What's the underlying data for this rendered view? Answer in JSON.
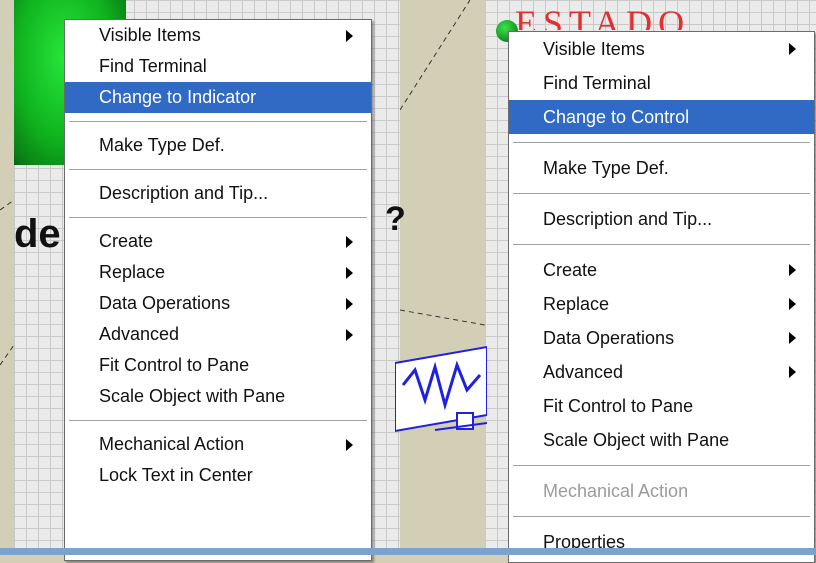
{
  "background": {
    "left_label": "de",
    "left_label_suffix": "?",
    "right_title": "ESTADO"
  },
  "menu_left": {
    "items": [
      {
        "label": "Visible Items",
        "submenu": true
      },
      {
        "label": "Find Terminal"
      },
      {
        "label": "Change to Indicator",
        "selected": true
      },
      {
        "separator": true
      },
      {
        "label": "Make Type Def."
      },
      {
        "separator": true
      },
      {
        "label": "Description and Tip..."
      },
      {
        "separator": true
      },
      {
        "label": "Create",
        "submenu": true
      },
      {
        "label": "Replace",
        "submenu": true
      },
      {
        "label": "Data Operations",
        "submenu": true
      },
      {
        "label": "Advanced",
        "submenu": true
      },
      {
        "label": "Fit Control to Pane"
      },
      {
        "label": "Scale Object with Pane"
      },
      {
        "separator": true
      },
      {
        "label": "Mechanical Action",
        "submenu": true
      },
      {
        "label": "Lock Text in Center"
      }
    ]
  },
  "menu_right": {
    "items": [
      {
        "label": "Visible Items",
        "submenu": true
      },
      {
        "label": "Find Terminal"
      },
      {
        "label": "Change to Control",
        "selected": true
      },
      {
        "separator": true
      },
      {
        "label": "Make Type Def."
      },
      {
        "separator": true
      },
      {
        "label": "Description and Tip..."
      },
      {
        "separator": true
      },
      {
        "label": "Create",
        "submenu": true
      },
      {
        "label": "Replace",
        "submenu": true
      },
      {
        "label": "Data Operations",
        "submenu": true
      },
      {
        "label": "Advanced",
        "submenu": true
      },
      {
        "label": "Fit Control to Pane"
      },
      {
        "label": "Scale Object with Pane"
      },
      {
        "separator": true
      },
      {
        "label": "Mechanical Action",
        "disabled": true
      },
      {
        "separator": true
      },
      {
        "label": "Properties"
      }
    ]
  },
  "colors": {
    "selection": "#316ac5",
    "knob_green": "#0fb21e",
    "title_red": "#e23030",
    "wire_blue": "#2020e0"
  }
}
